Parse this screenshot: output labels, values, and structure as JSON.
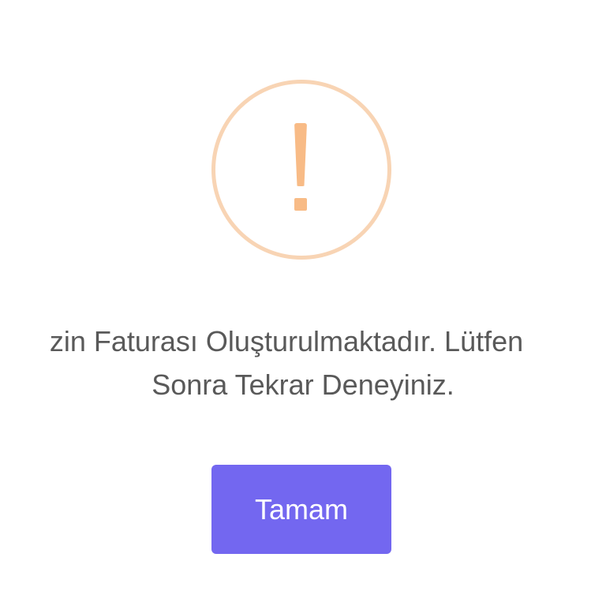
{
  "dialog": {
    "icon": "warning-exclamation-icon",
    "icon_color": "#f8bb86",
    "icon_ring_color": "#f8d4b4",
    "message_line_1": "zin Faturası Oluşturulmaktadır. Lütfen",
    "message_line_2": "Sonra Tekrar Deneyiniz.",
    "confirm_label": "Tamam",
    "confirm_color": "#7367f0",
    "text_color": "#595959"
  }
}
